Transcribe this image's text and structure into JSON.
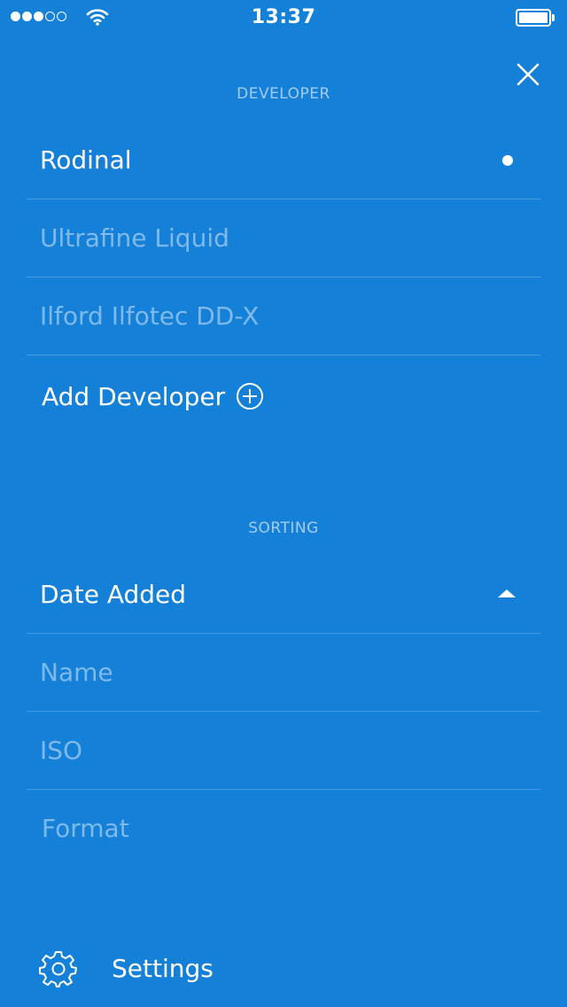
{
  "status_bar": {
    "signal_filled": 3,
    "signal_total": 5,
    "time": "13:37",
    "battery_level": 1.0
  },
  "close_icon": "close-icon",
  "developer_section": {
    "heading": "DEVELOPER",
    "items": [
      {
        "label": "Rodinal",
        "selected": true
      },
      {
        "label": "Ultrafine Liquid",
        "selected": false
      },
      {
        "label": "Ilford Ilfotec DD-X",
        "selected": false
      }
    ],
    "add_label": "Add Developer",
    "add_icon": "plus-circle-icon"
  },
  "sorting_section": {
    "heading": "SORTING",
    "items": [
      {
        "label": "Date Added",
        "selected": true,
        "direction": "ascending"
      },
      {
        "label": "Name",
        "selected": false
      },
      {
        "label": "ISO",
        "selected": false
      },
      {
        "label": "Format",
        "selected": false
      }
    ]
  },
  "footer": {
    "settings_label": "Settings",
    "settings_icon": "gear-icon"
  },
  "colors": {
    "background": "#1580d8",
    "text": "#ffffff",
    "text_dim": "rgba(255,255,255,0.45)"
  }
}
